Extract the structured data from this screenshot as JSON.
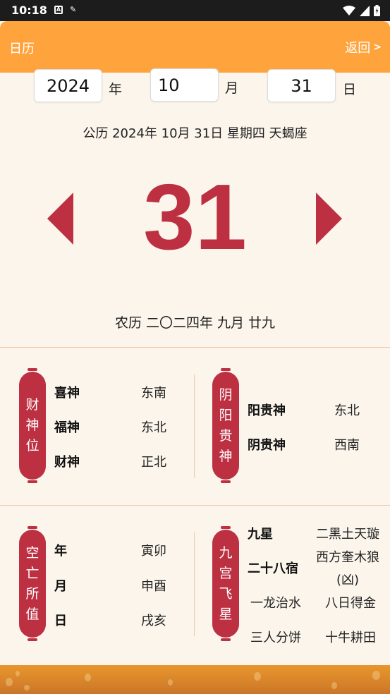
{
  "status_bar": {
    "time": "10:18",
    "icons": [
      "a-icon",
      "tool-icon",
      "wifi-icon",
      "signal-icon",
      "battery-icon"
    ]
  },
  "app_bar": {
    "title": "日历",
    "back_label": "返回",
    "back_chevron": ">"
  },
  "date_inputs": {
    "year_value": "2024",
    "year_unit": "年",
    "month_value": "10",
    "month_unit": "月",
    "day_value": "31",
    "day_unit": "日"
  },
  "solar_date": "公历 2024年 10月 31日 星期四 天蝎座",
  "big_day": "31",
  "lunar_date": "农历 二〇二四年 九月 廿九",
  "colors": {
    "accent_orange": "#ffa43c",
    "deep_red": "#bd3042",
    "background": "#fbf5ec"
  },
  "section1": {
    "left": {
      "tag": [
        "财",
        "神",
        "位"
      ],
      "rows": [
        {
          "label": "喜神",
          "value": "东南"
        },
        {
          "label": "福神",
          "value": "东北"
        },
        {
          "label": "财神",
          "value": "正北"
        }
      ]
    },
    "right": {
      "tag": [
        "阴",
        "阳",
        "贵",
        "神"
      ],
      "rows": [
        {
          "label": "阳贵神",
          "value": "东北"
        },
        {
          "label": "阴贵神",
          "value": "西南"
        }
      ]
    }
  },
  "section2": {
    "left": {
      "tag": [
        "空",
        "亡",
        "所",
        "值"
      ],
      "rows": [
        {
          "label": "年",
          "value": "寅卯"
        },
        {
          "label": "月",
          "value": "申酉"
        },
        {
          "label": "日",
          "value": "戌亥"
        }
      ]
    },
    "right": {
      "tag": [
        "九",
        "宫",
        "飞",
        "星"
      ],
      "nine_star_label": "九星",
      "nine_star_value": "二黑土天璇",
      "mansion_label": "二十八宿",
      "mansion_value_1": "西方奎木狼",
      "mansion_value_2": "(凶)",
      "items": [
        "一龙治水",
        "八日得金",
        "三人分饼",
        "十牛耕田"
      ]
    }
  }
}
